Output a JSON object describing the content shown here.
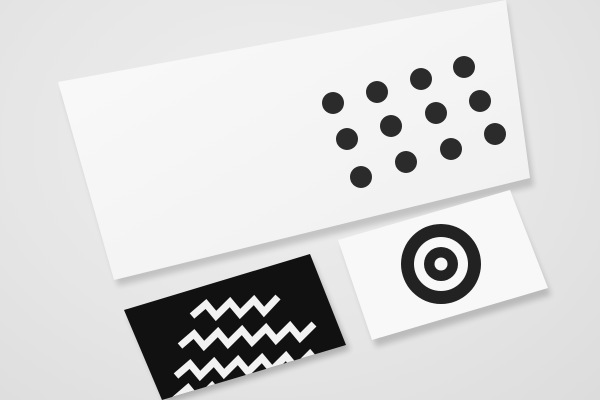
{
  "scene": {
    "subject": "stationery-mockup",
    "colors": {
      "background": "#e4e4e4",
      "paper": "#f7f7f7",
      "ink": "#2b2b2b",
      "black_card": "#111111"
    },
    "items": {
      "envelope": {
        "pattern": "dot-grid",
        "dot_count": 12
      },
      "black_business_card": {
        "pattern": "zigzag-stripes",
        "stripe_count": 4
      },
      "white_business_card": {
        "pattern": "target-rings",
        "ring_count": 2
      }
    }
  }
}
